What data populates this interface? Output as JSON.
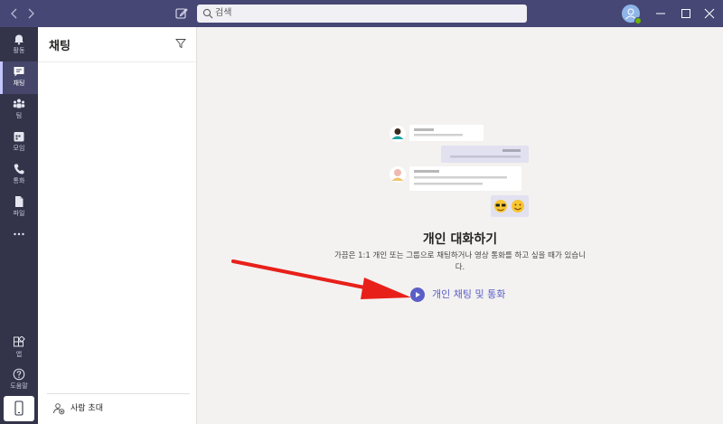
{
  "titlebar": {
    "search_placeholder": "검색"
  },
  "rail": {
    "items": [
      {
        "label": "활동",
        "icon": "bell-icon"
      },
      {
        "label": "채팅",
        "icon": "chat-icon"
      },
      {
        "label": "팀",
        "icon": "teams-icon"
      },
      {
        "label": "모임",
        "icon": "calendar-icon"
      },
      {
        "label": "통화",
        "icon": "phone-icon"
      },
      {
        "label": "파일",
        "icon": "file-icon"
      }
    ],
    "more_icon": "ellipsis-icon",
    "apps_label": "앱",
    "help_label": "도움말"
  },
  "chatlist": {
    "title": "채팅",
    "invite_label": "사람 초대"
  },
  "main": {
    "title": "개인 대화하기",
    "description": "가끔은 1:1 개인 또는 그룹으로 채팅하거나 영상 통화를 하고 싶을 때가 있습니다.",
    "cta_label": "개인 채팅 및 통화"
  },
  "colors": {
    "titlebar": "#464775",
    "rail": "#33344a",
    "accent": "#5b5fc7",
    "arrow": "#e8201a"
  }
}
